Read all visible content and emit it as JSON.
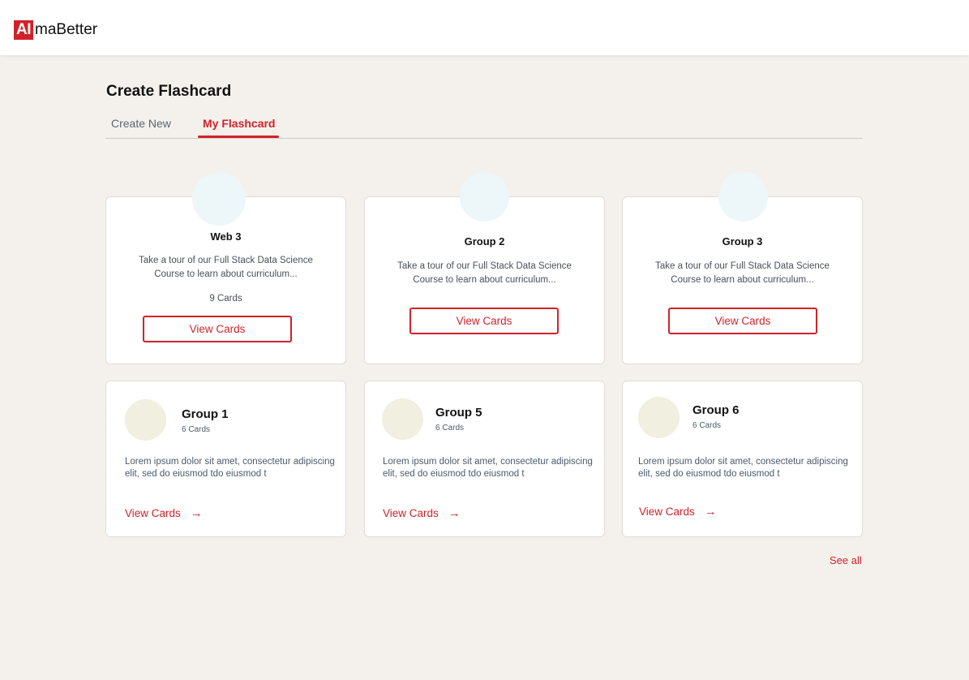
{
  "brand": {
    "logo_mark": "AI",
    "logo_text": "maBetter",
    "accent": "#d1222a"
  },
  "page": {
    "title": "Create Flashcard"
  },
  "tabs": [
    {
      "label": "Create New",
      "active": false
    },
    {
      "label": "My Flashcard",
      "active": true
    }
  ],
  "featured_cards": [
    {
      "title": "Web 3",
      "description": "Take a tour of our Full Stack Data Science Course to learn about curriculum...",
      "count": "9 Cards",
      "button": "View Cards"
    },
    {
      "title": "Group 2",
      "description": "Take a tour of our Full Stack Data Science Course to learn about curriculum...",
      "button": "View Cards"
    },
    {
      "title": "Group 3",
      "description": "Take a tour of our Full Stack Data Science Course to learn about curriculum...",
      "button": "View Cards"
    }
  ],
  "group_cards": [
    {
      "title": "Group 1",
      "count": "6 Cards",
      "description": "Lorem ipsum dolor sit amet, consectetur adipiscing elit, sed do eiusmod tdo eiusmod t",
      "link": "View Cards",
      "arrow": "→"
    },
    {
      "title": "Group 5",
      "count": "6 Cards",
      "description": "Lorem ipsum dolor sit amet, consectetur adipiscing elit, sed do eiusmod tdo eiusmod t",
      "link": "View Cards",
      "arrow": "→"
    },
    {
      "title": "Group 6",
      "count": "6 Cards",
      "description": "Lorem ipsum dolor sit amet, consectetur adipiscing elit, sed do eiusmod tdo eiusmod t",
      "link": "View Cards",
      "arrow": "→"
    }
  ],
  "see_all": "See all"
}
